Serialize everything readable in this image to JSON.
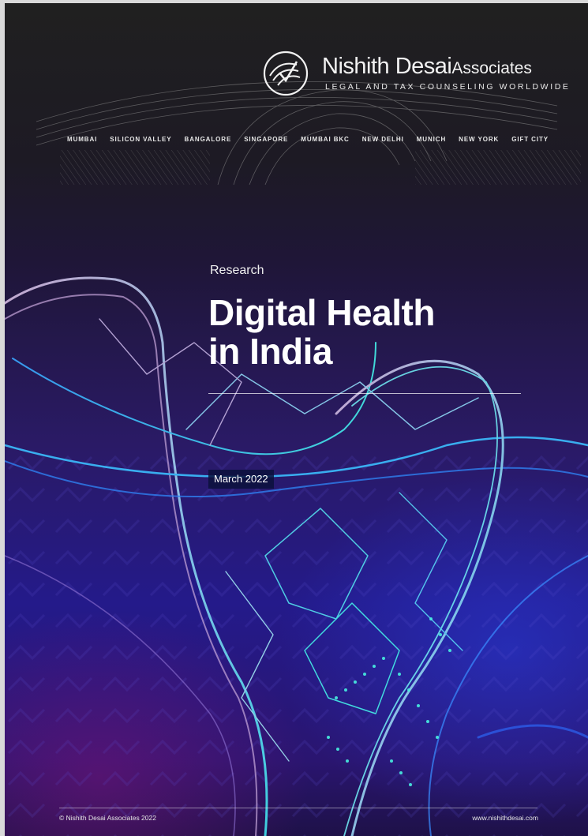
{
  "brand": {
    "name": "Nishith Desai",
    "name_suffix": "Associates",
    "tagline": "LEGAL AND TAX COUNSELING WORLDWIDE"
  },
  "offices": [
    "MUMBAI",
    "SILICON VALLEY",
    "BANGALORE",
    "SINGAPORE",
    "MUMBAI BKC",
    "NEW DELHI",
    "MUNICH",
    "NEW YORK",
    "GIFT CITY"
  ],
  "cover": {
    "kicker": "Research",
    "title_line1": "Digital Health",
    "title_line2": "in India",
    "date": "March 2022"
  },
  "footer": {
    "copyright": "© Nishith Desai Associates 2022",
    "website": "www.nishithdesai.com"
  },
  "colors": {
    "header_bg": "#202020",
    "body_bg": "#241a8a",
    "accent_cyan": "#3fe0e8",
    "accent_pink": "#c9a6d8"
  }
}
